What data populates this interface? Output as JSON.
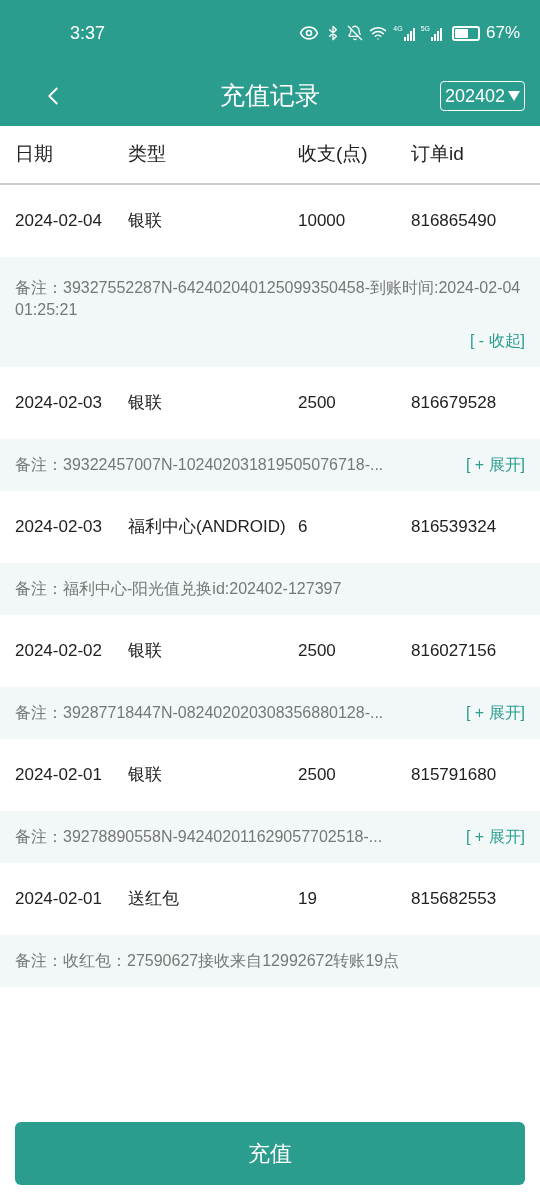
{
  "status_bar": {
    "time": "3:37",
    "network_labels": [
      "4G",
      "5G"
    ],
    "battery_text": "67%"
  },
  "header": {
    "title": "充值记录",
    "month_selector": "202402"
  },
  "table": {
    "columns": [
      "日期",
      "类型",
      "收支(点)",
      "订单id"
    ],
    "rows": [
      {
        "date": "2024-02-04",
        "type": "银联",
        "amount": "10000",
        "order_id": "816865490",
        "note": "备注：39327552287N-642402040125099350458-到账时间:2024-02-04 01:25:21",
        "toggle": {
          "label": "[ - 收起]",
          "kind": "collapse"
        }
      },
      {
        "date": "2024-02-03",
        "type": "银联",
        "amount": "2500",
        "order_id": "816679528",
        "note": "备注：39322457007N-102402031819505076718-...",
        "toggle": {
          "label": "[ + 展开]",
          "kind": "expand"
        }
      },
      {
        "date": "2024-02-03",
        "type": "福利中心(ANDROID)",
        "amount": "6",
        "order_id": "816539324",
        "note": "备注：福利中心-阳光值兑换id:202402-127397"
      },
      {
        "date": "2024-02-02",
        "type": "银联",
        "amount": "2500",
        "order_id": "816027156",
        "note": "备注：39287718447N-082402020308356880128-...",
        "toggle": {
          "label": "[ + 展开]",
          "kind": "expand"
        }
      },
      {
        "date": "2024-02-01",
        "type": "银联",
        "amount": "2500",
        "order_id": "815791680",
        "note": "备注：39278890558N-942402011629057702518-...",
        "toggle": {
          "label": "[ + 展开]",
          "kind": "expand"
        }
      },
      {
        "date": "2024-02-01",
        "type": "送红包",
        "amount": "19",
        "order_id": "815682553",
        "note": "备注：收红包：27590627接收来自12992672转账19点"
      }
    ]
  },
  "recharge_button": "充值"
}
